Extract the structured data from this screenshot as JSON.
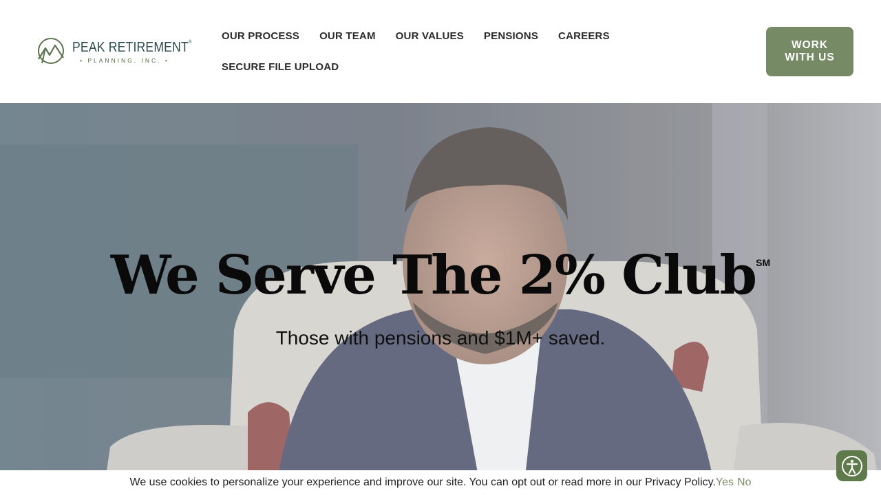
{
  "brand": {
    "name": "PEAK RETIREMENT",
    "trademark": "®",
    "sub": "• PLANNING, INC. •",
    "accent": "#778a66",
    "logo_color": "#2e4a4c"
  },
  "nav": {
    "row1": [
      "OUR PROCESS",
      "OUR TEAM",
      "OUR VALUES",
      "PENSIONS",
      "CAREERS"
    ],
    "row2": [
      "SECURE FILE UPLOAD"
    ]
  },
  "cta": {
    "line1": "WORK",
    "line2": "WITH US"
  },
  "hero": {
    "title": "We Serve The 2% Club",
    "title_mark": "SM",
    "subtitle": "Those with pensions and $1M+ saved."
  },
  "cookie": {
    "text": "We use cookies to personalize your experience and improve our site. You can opt out or read more in our Privacy Policy.",
    "yes": "Yes",
    "no": "No"
  },
  "accessibility": {
    "icon": "accessibility-icon",
    "color": "#5f7a4a"
  }
}
